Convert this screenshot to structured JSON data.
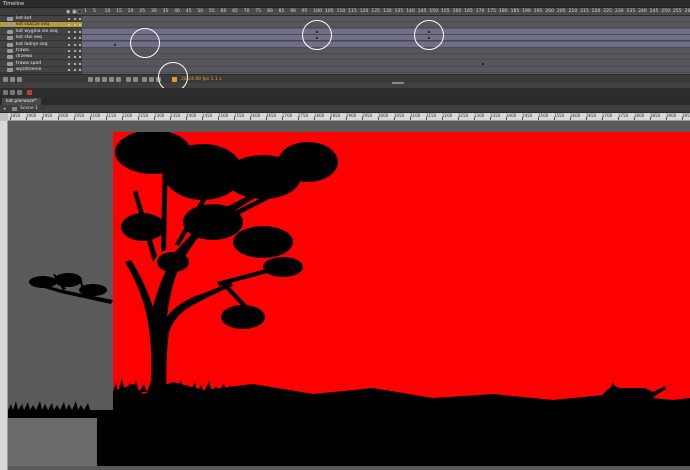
{
  "panel": {
    "title": "Timeline"
  },
  "timeline": {
    "frame_numbers": [
      "1",
      "5",
      "10",
      "15",
      "20",
      "25",
      "30",
      "35",
      "40",
      "45",
      "50",
      "55",
      "60",
      "65",
      "70",
      "75",
      "80",
      "85",
      "90",
      "95",
      "100",
      "105",
      "110",
      "115",
      "120",
      "125",
      "130",
      "135",
      "140",
      "145",
      "150",
      "155",
      "160",
      "165",
      "170",
      "175",
      "180",
      "185",
      "190",
      "195",
      "200",
      "205",
      "210",
      "215",
      "220",
      "225",
      "230",
      "235",
      "240",
      "245",
      "250",
      "255",
      "260"
    ],
    "layers": [
      {
        "name": "kot kot",
        "selected": false
      },
      {
        "name": "kot skacze seq",
        "selected": true
      },
      {
        "name": "kot wygina sie seq",
        "selected": false
      },
      {
        "name": "kot stoi seq",
        "selected": false
      },
      {
        "name": "kot ladnje seq",
        "selected": false
      },
      {
        "name": "trawa",
        "selected": false
      },
      {
        "name": "drzewo",
        "selected": false
      },
      {
        "name": "trawa spod",
        "selected": false
      },
      {
        "name": "wyzdrzenie",
        "selected": false
      }
    ],
    "status": "28  24.00 fps  1.1 s",
    "playhead_frame": 28
  },
  "document": {
    "tab_label": "kot pierwsze*",
    "scene_label": "Scene 1"
  },
  "ruler": {
    "h_ticks": [
      "1850",
      "1900",
      "1950",
      "2000",
      "2050",
      "2100",
      "2150",
      "2200",
      "2250",
      "2300",
      "2350",
      "2400",
      "2450",
      "2500",
      "2550",
      "2600",
      "2650",
      "2700",
      "2750",
      "2800",
      "2850",
      "2900",
      "2950",
      "3000",
      "3050",
      "3100",
      "3150",
      "3200",
      "3250",
      "3300",
      "3350",
      "3400",
      "3450",
      "3500",
      "3550",
      "3600",
      "3650",
      "3700",
      "3750",
      "3800",
      "3850",
      "3900",
      "3950",
      "4000"
    ]
  },
  "colors": {
    "stage_bg": "#ff0000",
    "silhouette": "#000000",
    "selected_layer": "#b89a3a",
    "playhead": "#e02020"
  },
  "icons": [
    "eye-icon",
    "lock-icon",
    "outline-icon",
    "play-icon",
    "loop-icon",
    "onion-skin-icon",
    "pencil-icon",
    "folder-icon",
    "trash-icon",
    "back-arrow-icon",
    "scene-icon"
  ]
}
